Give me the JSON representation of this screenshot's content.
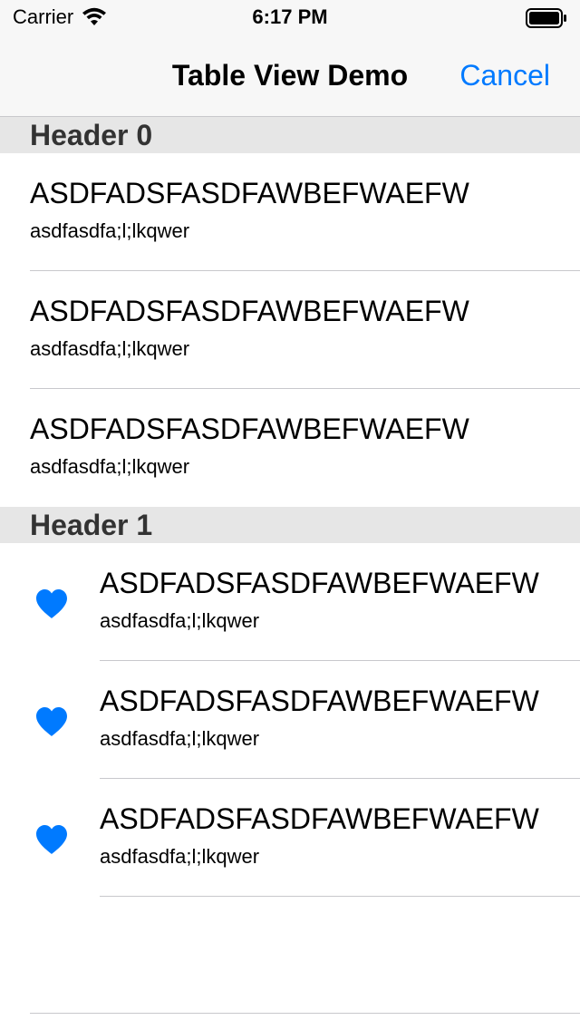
{
  "status_bar": {
    "carrier": "Carrier",
    "time": "6:17 PM",
    "icons": [
      "wifi-icon",
      "battery-icon"
    ]
  },
  "nav": {
    "title": "Table View Demo",
    "cancel_label": "Cancel",
    "accent_color": "#007aff"
  },
  "sections": [
    {
      "header": "Header 0",
      "rows": [
        {
          "title": "ASDFADSFASDFAWBEFWAEFW",
          "subtitle": "asdfasdfa;l;lkqwer"
        },
        {
          "title": "ASDFADSFASDFAWBEFWAEFW",
          "subtitle": "asdfasdfa;l;lkqwer"
        },
        {
          "title": "ASDFADSFASDFAWBEFWAEFW",
          "subtitle": "asdfasdfa;l;lkqwer"
        }
      ]
    },
    {
      "header": "Header 1",
      "row_icon": "heart-icon",
      "rows": [
        {
          "title": "ASDFADSFASDFAWBEFWAEFW",
          "subtitle": "asdfasdfa;l;lkqwer"
        },
        {
          "title": "ASDFADSFASDFAWBEFWAEFW",
          "subtitle": "asdfasdfa;l;lkqwer"
        },
        {
          "title": "ASDFADSFASDFAWBEFWAEFW",
          "subtitle": "asdfasdfa;l;lkqwer"
        }
      ]
    }
  ]
}
